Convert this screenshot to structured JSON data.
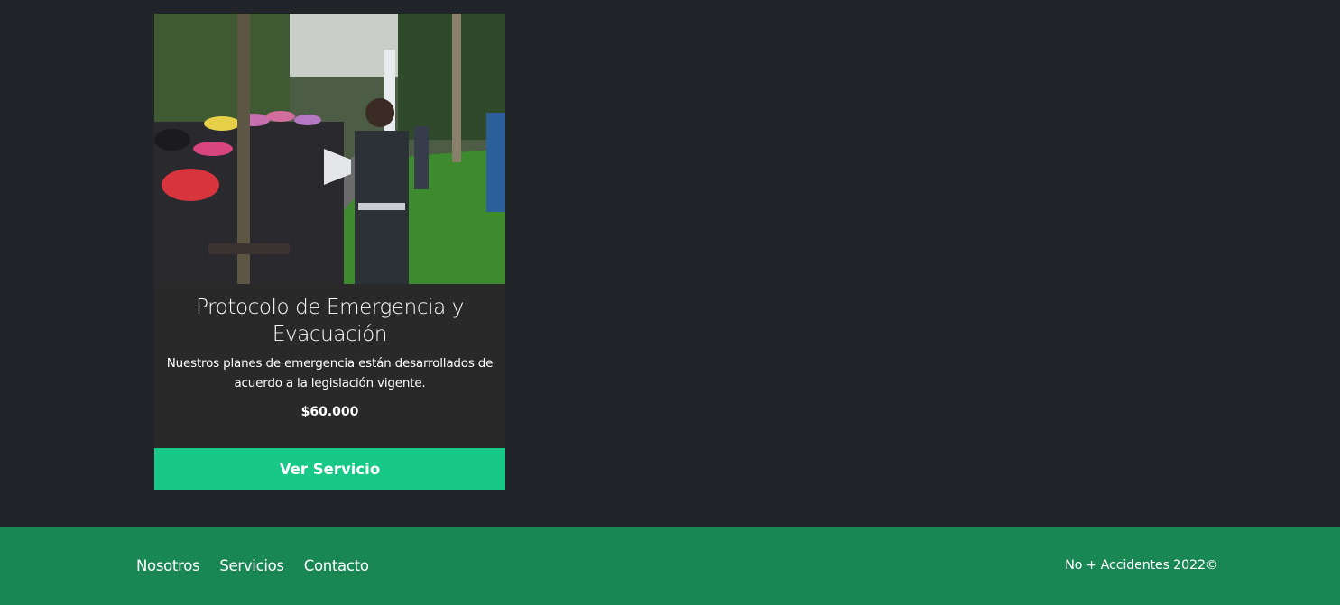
{
  "service_card": {
    "image_alt": "Protocolo de Emergencia y Evacuación",
    "title": "Protocolo de Emergencia y Evacuación",
    "description": "Nuestros planes de emergencia están desarrollados de acuerdo a la legislación vigente.",
    "price": "$60.000",
    "button_label": "Ver Servicio"
  },
  "footer": {
    "nav": [
      {
        "label": "Nosotros"
      },
      {
        "label": "Servicios"
      },
      {
        "label": "Contacto"
      }
    ],
    "copyright": "No + Accidentes 2022©"
  },
  "colors": {
    "page_background": "#212529",
    "card_background": "#292929",
    "button": "#17c887",
    "footer": "#198754",
    "text": "#ffffff"
  }
}
